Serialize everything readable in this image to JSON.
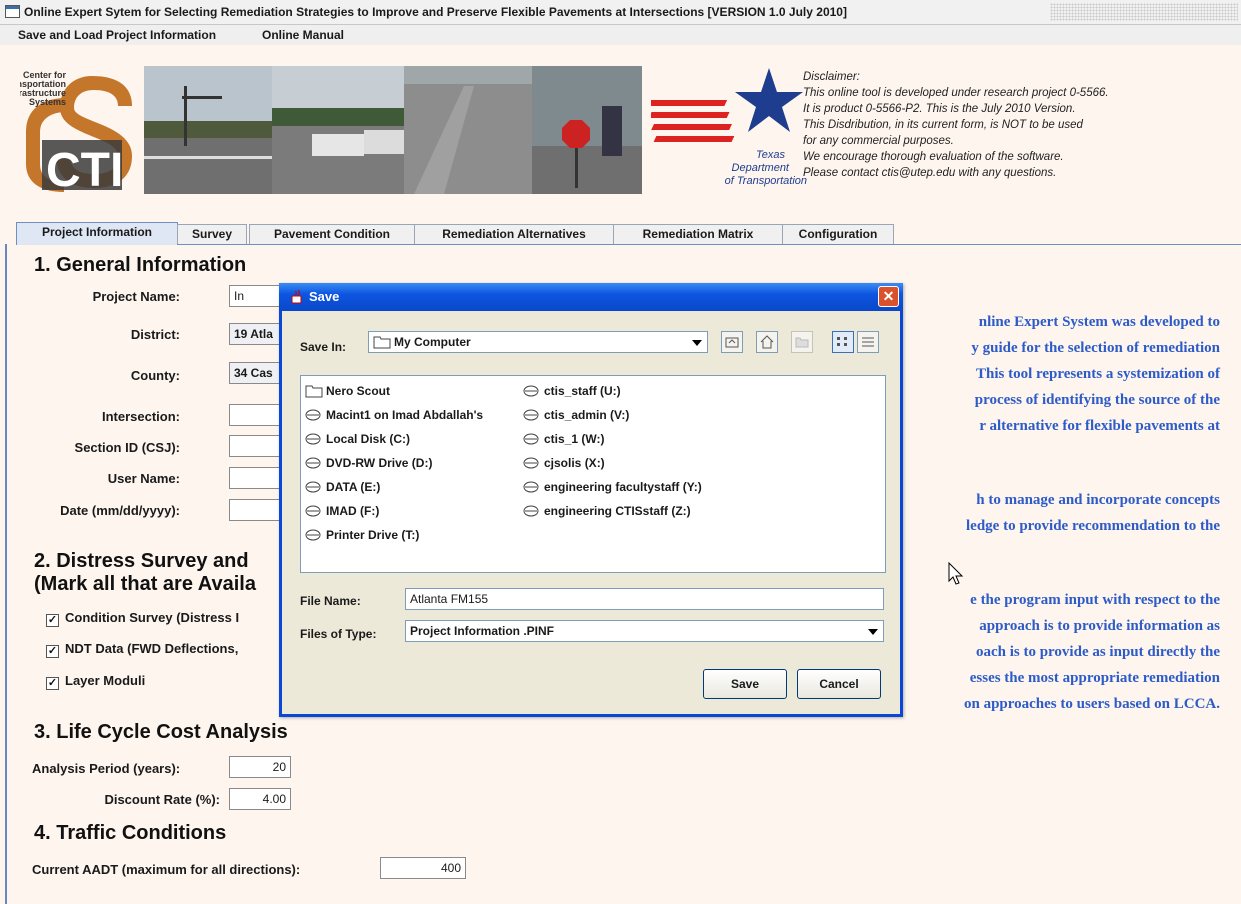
{
  "window": {
    "title": "Online Expert Sytem for Selecting Remediation Strategies to Improve and Preserve Flexible Pavements at Intersections [VERSION 1.0 July 2010]"
  },
  "menu": {
    "items": [
      "Save and Load Project Information",
      "Online Manual"
    ]
  },
  "banner": {
    "cti_logo_lines": [
      "Center for",
      "Transportation",
      "Infrastructure",
      "Systems"
    ],
    "cti_letters": "CTI",
    "txdot_lines": [
      "Texas",
      "Department",
      "of Transportation"
    ],
    "disclaimer": [
      "Disclaimer:",
      "This online tool is developed under research project 0-5566.",
      "It is product 0-5566-P2. This is the July 2010 Version.",
      "This Disdribution, in its current form, is NOT to be used",
      "for any commercial purposes.",
      "We encourage thorough evaluation of the software.",
      "Please contact ctis@utep.edu with any questions."
    ]
  },
  "tabs": [
    "Project Information",
    "Survey",
    "Pavement Condition",
    "Remediation Alternatives",
    "Remediation Matrix",
    "Configuration"
  ],
  "general": {
    "heading": "1. General Information",
    "project_name_label": "Project Name:",
    "project_name_value": "In",
    "district_label": "District:",
    "district_value": "19 Atla",
    "county_label": "County:",
    "county_value": "34 Cas",
    "intersection_label": "Intersection:",
    "section_label": "Section ID (CSJ):",
    "user_label": "User Name:",
    "date_label": "Date (mm/dd/yyyy):"
  },
  "distress": {
    "heading_line1": "2. Distress Survey and",
    "heading_line2": "(Mark all that are Availa",
    "checkboxes": [
      "Condition Survey (Distress I",
      "NDT Data (FWD Deflections,",
      "Layer Moduli"
    ]
  },
  "lcca": {
    "heading": "3. Life Cycle Cost Analysis",
    "period_label": "Analysis Period (years):",
    "period_value": "20",
    "rate_label": "Discount Rate (%):",
    "rate_value": "4.00"
  },
  "traffic": {
    "heading": "4. Traffic Conditions",
    "aadt_label": "Current AADT (maximum for all directions):",
    "aadt_value": "400"
  },
  "intro_lines": [
    "nline Expert System was developed to",
    "y guide for the selection of remediation",
    "This tool represents a systemization of",
    "process of identifying the source of the",
    "r alternative for flexible pavements at",
    "h to manage and incorporate concepts",
    "ledge to provide recommendation to the",
    "e the program input with respect to the",
    "approach is to provide information as",
    "oach is to provide as input directly the",
    "esses the most appropriate remediation",
    "on approaches to users based on LCCA."
  ],
  "dialog": {
    "title": "Save",
    "save_in_label": "Save In:",
    "save_in_value": "My Computer",
    "files": [
      "Nero Scout",
      "Macint1 on Imad Abdallah's",
      "Local Disk (C:)",
      "DVD-RW Drive (D:)",
      "DATA (E:)",
      "IMAD (F:)",
      "Printer Drive (T:)",
      "ctis_staff (U:)",
      "ctis_admin (V:)",
      "ctis_1 (W:)",
      "cjsolis (X:)",
      "engineering facultystaff (Y:)",
      "engineering CTISstaff (Z:)"
    ],
    "file_name_label": "File Name:",
    "file_name_value": "Atlanta FM155",
    "file_type_label": "Files of Type:",
    "file_type_value": "Project Information .PINF",
    "save_button": "Save",
    "cancel_button": "Cancel"
  },
  "colors": {
    "dialog_title": "#0d55e0",
    "intro_text": "#2d5bc8",
    "background": "#fdf5ee"
  }
}
